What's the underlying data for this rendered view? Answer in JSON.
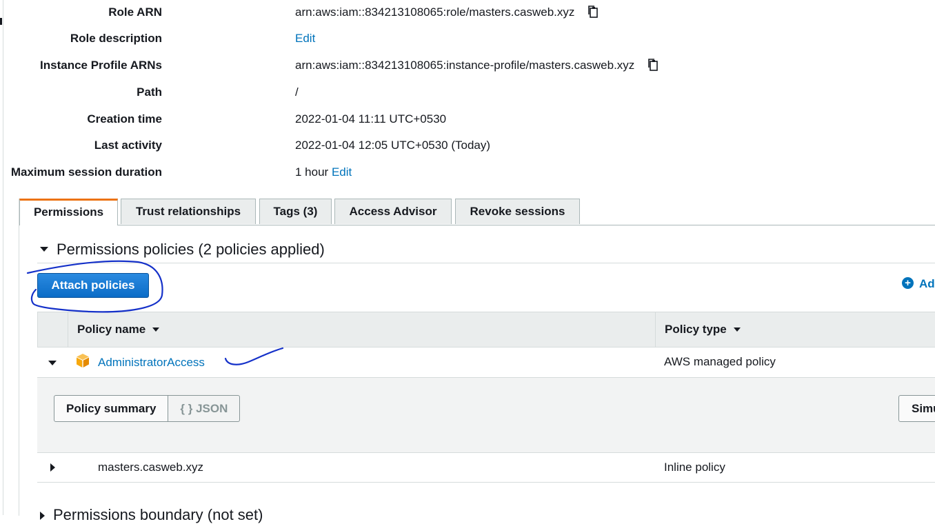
{
  "summary": {
    "role_arn": {
      "label": "Role ARN",
      "value": "arn:aws:iam::834213108065:role/masters.casweb.xyz"
    },
    "role_description": {
      "label": "Role description",
      "edit": "Edit"
    },
    "instance_profile": {
      "label": "Instance Profile ARNs",
      "value": "arn:aws:iam::834213108065:instance-profile/masters.casweb.xyz"
    },
    "path": {
      "label": "Path",
      "value": "/"
    },
    "creation_time": {
      "label": "Creation time",
      "value": "2022-01-04 11:11 UTC+0530"
    },
    "last_activity": {
      "label": "Last activity",
      "value": "2022-01-04 12:05 UTC+0530 (Today)"
    },
    "max_session": {
      "label": "Maximum session duration",
      "value": "1 hour",
      "edit": "Edit"
    }
  },
  "tabs": [
    {
      "label": "Permissions",
      "active": true
    },
    {
      "label": "Trust relationships",
      "active": false
    },
    {
      "label": "Tags (3)",
      "active": false
    },
    {
      "label": "Access Advisor",
      "active": false
    },
    {
      "label": "Revoke sessions",
      "active": false
    }
  ],
  "permissions": {
    "heading": "Permissions policies (2 policies applied)",
    "attach_button": "Attach policies",
    "add_inline": "Ad",
    "columns": {
      "policy_name": "Policy name",
      "policy_type": "Policy type"
    },
    "rows": [
      {
        "name": "AdministratorAccess",
        "type": "AWS managed policy",
        "expanded": true
      },
      {
        "name": "masters.casweb.xyz",
        "type": "Inline policy",
        "expanded": false
      }
    ],
    "detail": {
      "summary_btn": "Policy summary",
      "json_btn": "{ } JSON",
      "simulate_btn": "Simu"
    }
  },
  "boundary": {
    "heading": "Permissions boundary (not set)"
  },
  "colors": {
    "accent": "#0073bb",
    "tab_active": "#ec7211",
    "button": "#0b6cc7",
    "aws_icon": "#f7a80d",
    "annotation": "#1531c9"
  },
  "icons": [
    "copy-icon",
    "caret-down-icon",
    "caret-right-icon",
    "plus-circle-icon",
    "aws-cube-icon"
  ]
}
